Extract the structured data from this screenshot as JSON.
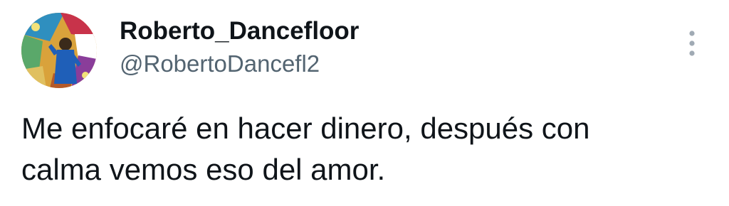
{
  "author": {
    "display_name": "Roberto_Dancefloor",
    "handle": "@RobertoDancefl2",
    "avatar_icon": "avatar-image"
  },
  "menu": {
    "icon": "more-vertical-icon"
  },
  "tweet": {
    "text": "Me enfocaré en hacer dinero, después con\ncalma vemos eso del amor."
  },
  "colors": {
    "text_primary": "#0f1419",
    "text_secondary": "#536471",
    "icon_gray": "#a0aab4"
  }
}
